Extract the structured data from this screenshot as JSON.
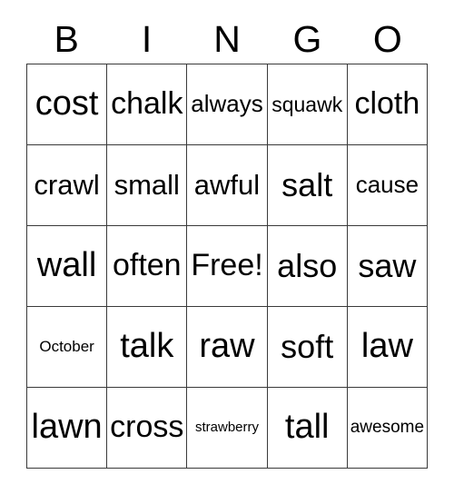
{
  "card": {
    "title": "BINGO",
    "header_letters": [
      "B",
      "I",
      "N",
      "G",
      "O"
    ],
    "columns": 5,
    "rows": 5,
    "free_space": "Free!",
    "free_space_position": {
      "row": 3,
      "column": 3
    },
    "colors": {
      "background": "#ffffff",
      "text": "#000000",
      "grid_line": "#3a3a3a"
    },
    "cells": [
      [
        {
          "text": "cost",
          "size": "fs-xxl"
        },
        {
          "text": "chalk",
          "size": "fs-l"
        },
        {
          "text": "always",
          "size": "fs-sm"
        },
        {
          "text": "squawk",
          "size": "fs-s"
        },
        {
          "text": "cloth",
          "size": "fs-l"
        }
      ],
      [
        {
          "text": "crawl",
          "size": "fs-ml"
        },
        {
          "text": "small",
          "size": "fs-ml"
        },
        {
          "text": "awful",
          "size": "fs-ml"
        },
        {
          "text": "salt",
          "size": "fs-xl"
        },
        {
          "text": "cause",
          "size": "fs-sm"
        }
      ],
      [
        {
          "text": "wall",
          "size": "fs-xxl"
        },
        {
          "text": "often",
          "size": "fs-l"
        },
        {
          "text": "Free!",
          "size": "fs-l"
        },
        {
          "text": "also",
          "size": "fs-xl"
        },
        {
          "text": "saw",
          "size": "fs-xl"
        }
      ],
      [
        {
          "text": "October",
          "size": "fs-xxs"
        },
        {
          "text": "talk",
          "size": "fs-xxl"
        },
        {
          "text": "raw",
          "size": "fs-xxl"
        },
        {
          "text": "soft",
          "size": "fs-xl"
        },
        {
          "text": "law",
          "size": "fs-xxl"
        }
      ],
      [
        {
          "text": "lawn",
          "size": "fs-xxl"
        },
        {
          "text": "cross",
          "size": "fs-l"
        },
        {
          "text": "strawberry",
          "size": "fs-tiny"
        },
        {
          "text": "tall",
          "size": "fs-xxl"
        },
        {
          "text": "awesome",
          "size": "fs-xs"
        }
      ]
    ]
  }
}
